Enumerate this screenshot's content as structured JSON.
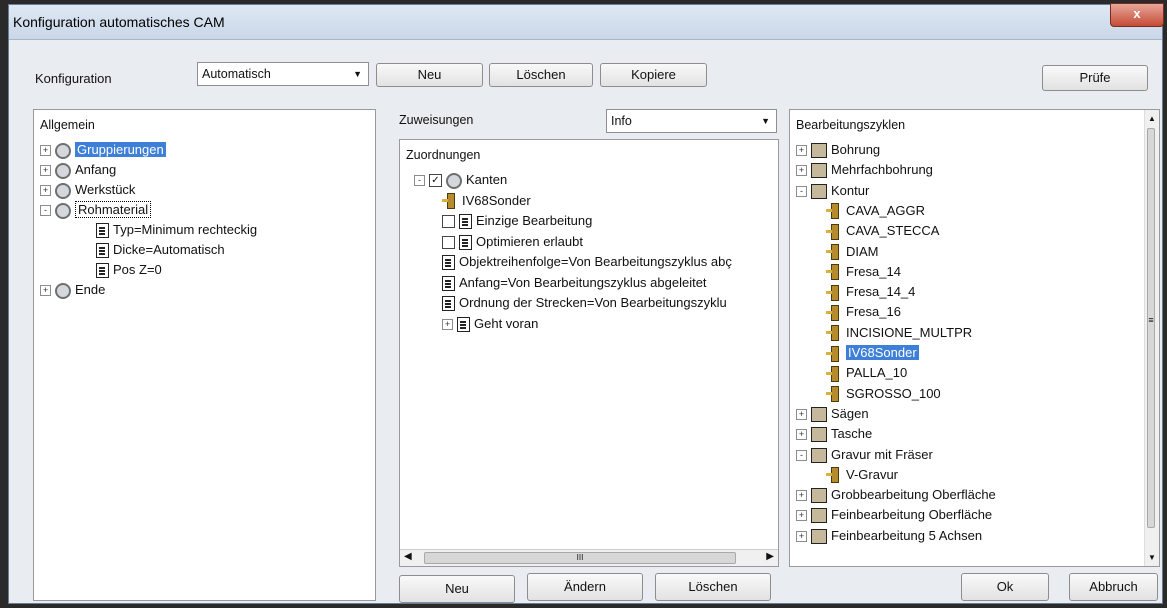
{
  "window": {
    "title": "Konfiguration automatisches CAM",
    "close_label": "x"
  },
  "top": {
    "konfig_label": "Konfiguration",
    "konfig_value": "Automatisch",
    "btn_neu": "Neu",
    "btn_loeschen": "Löschen",
    "btn_kopiere": "Kopiere",
    "btn_pruefe": "Prüfe"
  },
  "left": {
    "header": "Allgemein",
    "items": [
      {
        "label": "Gruppierungen",
        "level": 0,
        "expander": "+",
        "icon": "disk-icon",
        "selected": true
      },
      {
        "label": "Anfang",
        "level": 0,
        "expander": "+",
        "icon": "disk-icon"
      },
      {
        "label": "Werkstück",
        "level": 0,
        "expander": "+",
        "icon": "disk-icon"
      },
      {
        "label": "Rohmaterial",
        "level": 0,
        "expander": "-",
        "icon": "disk-icon",
        "focused": true
      },
      {
        "label": "Typ=Minimum rechteckig",
        "level": 1,
        "icon": "document-icon"
      },
      {
        "label": "Dicke=Automatisch",
        "level": 1,
        "icon": "document-icon"
      },
      {
        "label": "Pos Z=0",
        "level": 1,
        "icon": "document-icon"
      },
      {
        "label": "Ende",
        "level": 0,
        "expander": "+",
        "icon": "disk-icon"
      }
    ]
  },
  "middle": {
    "zuweisungen_label": "Zuweisungen",
    "combo_value": "Info",
    "header": "Zuordnungen",
    "items": [
      {
        "label": "Kanten",
        "level": 0,
        "expander": "-",
        "check": "checked",
        "icon": "disk-icon"
      },
      {
        "label": "IV68Sonder",
        "level": 1,
        "icon": "tool-icon"
      },
      {
        "label": "Einzige Bearbeitung",
        "level": 1,
        "check": "unchecked",
        "icon": "document-icon"
      },
      {
        "label": "Optimieren erlaubt",
        "level": 1,
        "check": "unchecked",
        "icon": "document-icon"
      },
      {
        "label": "Objektreihenfolge=Von Bearbeitungszyklus abç",
        "level": 1,
        "icon": "document-icon"
      },
      {
        "label": "Anfang=Von Bearbeitungszyklus abgeleitet",
        "level": 1,
        "icon": "document-icon"
      },
      {
        "label": "Ordnung der Strecken=Von Bearbeitungszyklu",
        "level": 1,
        "icon": "document-icon"
      },
      {
        "label": "Geht voran",
        "level": 1,
        "expander": "+",
        "icon": "document-icon"
      }
    ],
    "scroll_mark": "III",
    "btn_neu": "Neu",
    "btn_aendern": "Ändern",
    "btn_loeschen": "Löschen"
  },
  "right": {
    "header": "Bearbeitungszyklen",
    "items": [
      {
        "label": "Bohrung",
        "level": 0,
        "expander": "+",
        "icon": "drill-icon"
      },
      {
        "label": "Mehrfachbohrung",
        "level": 0,
        "expander": "+",
        "icon": "multidrill-icon"
      },
      {
        "label": "Kontur",
        "level": 0,
        "expander": "-",
        "icon": "book-icon"
      },
      {
        "label": "CAVA_AGGR",
        "level": 1,
        "icon": "tool-icon"
      },
      {
        "label": "CAVA_STECCA",
        "level": 1,
        "icon": "tool-icon"
      },
      {
        "label": "DIAM",
        "level": 1,
        "icon": "tool-icon"
      },
      {
        "label": "Fresa_14",
        "level": 1,
        "icon": "tool-icon"
      },
      {
        "label": "Fresa_14_4",
        "level": 1,
        "icon": "tool-icon"
      },
      {
        "label": "Fresa_16",
        "level": 1,
        "icon": "tool-icon"
      },
      {
        "label": "INCISIONE_MULTPR",
        "level": 1,
        "icon": "tool-icon"
      },
      {
        "label": "IV68Sonder",
        "level": 1,
        "icon": "tool-icon",
        "selected": true
      },
      {
        "label": "PALLA_10",
        "level": 1,
        "icon": "tool-icon"
      },
      {
        "label": "SGROSSO_100",
        "level": 1,
        "icon": "tool-icon"
      },
      {
        "label": "Sägen",
        "level": 0,
        "expander": "+",
        "icon": "saw-icon"
      },
      {
        "label": "Tasche",
        "level": 0,
        "expander": "+",
        "icon": "book-icon"
      },
      {
        "label": "Gravur mit Fräser",
        "level": 0,
        "expander": "-",
        "icon": "book-icon"
      },
      {
        "label": "V-Gravur",
        "level": 1,
        "icon": "engraver-icon"
      },
      {
        "label": "Grobbearbeitung Oberfläche",
        "level": 0,
        "expander": "+",
        "icon": "book-icon"
      },
      {
        "label": "Feinbearbeitung Oberfläche",
        "level": 0,
        "expander": "+",
        "icon": "book-icon"
      },
      {
        "label": "Feinbearbeitung 5 Achsen",
        "level": 0,
        "expander": "+",
        "icon": "book-icon"
      }
    ],
    "scroll_mark": "≡"
  },
  "bottom": {
    "btn_ok": "Ok",
    "btn_abbruch": "Abbruch"
  },
  "colors": {
    "selection": "#3e7fd8",
    "window_bg": "#e9ecf1"
  }
}
